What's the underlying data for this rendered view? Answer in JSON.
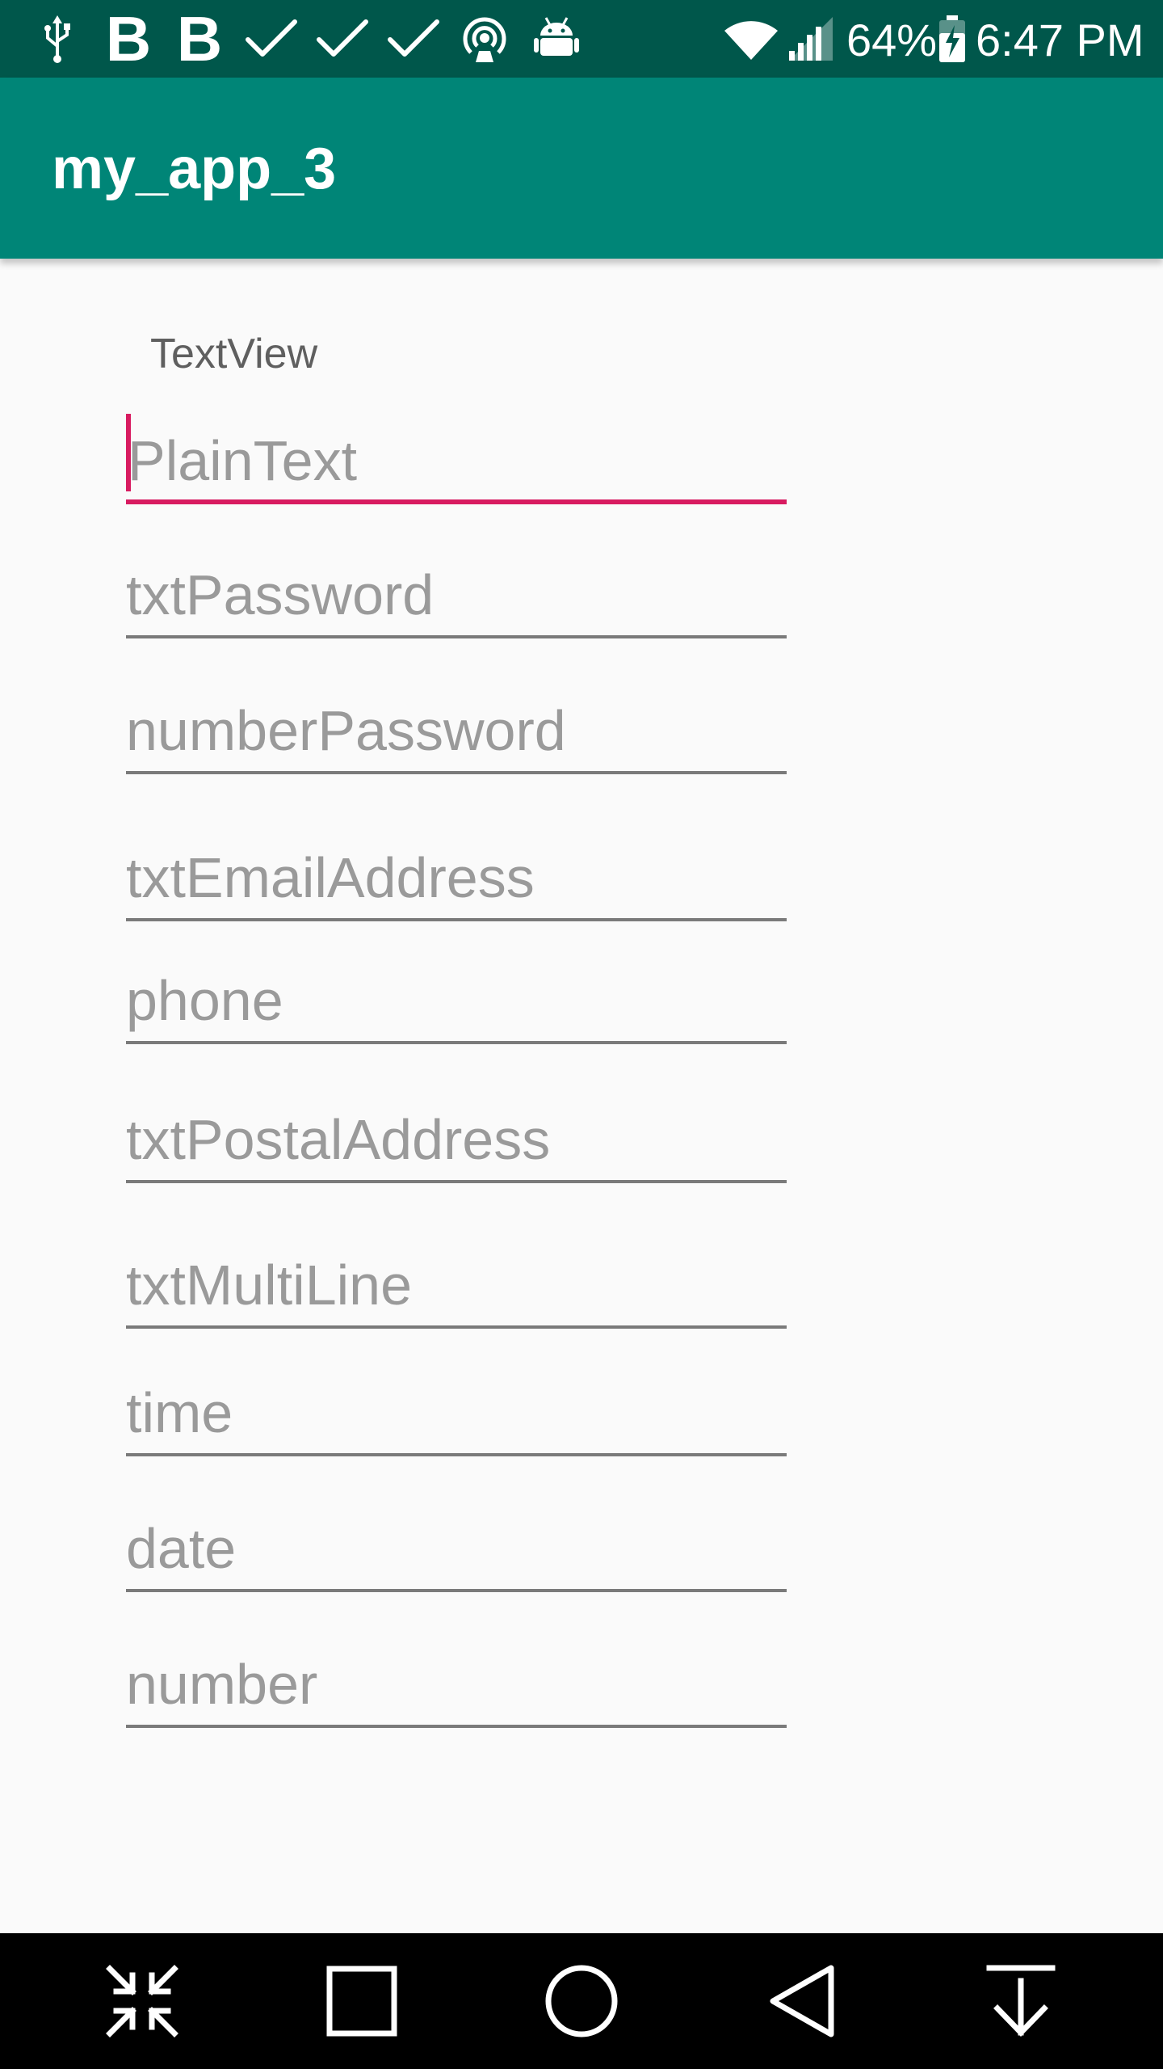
{
  "status_bar": {
    "left_icons": [
      "usb-icon",
      "b-icon",
      "b-icon",
      "check-icon",
      "check-icon",
      "check-icon",
      "hotspot-icon",
      "android-icon"
    ],
    "b_glyph_1": "B",
    "b_glyph_2": "B",
    "right_icons": [
      "wifi-icon",
      "signal-icon",
      "battery-charging-icon"
    ],
    "battery_percent": "64%",
    "time": "6:47 PM"
  },
  "app_bar": {
    "title": "my_app_3"
  },
  "content": {
    "textview_label": "TextView",
    "fields": [
      {
        "name": "plaintext",
        "placeholder": "PlainText",
        "focused": true
      },
      {
        "name": "txtpassword",
        "placeholder": "txtPassword"
      },
      {
        "name": "numberpassword",
        "placeholder": "numberPassword"
      },
      {
        "name": "txtemailaddress",
        "placeholder": "txtEmailAddress"
      },
      {
        "name": "phone",
        "placeholder": "phone"
      },
      {
        "name": "txtpostaladdress",
        "placeholder": "txtPostalAddress"
      },
      {
        "name": "txtmultiline",
        "placeholder": "txtMultiLine"
      },
      {
        "name": "time",
        "placeholder": "time"
      },
      {
        "name": "date",
        "placeholder": "date"
      },
      {
        "name": "number",
        "placeholder": "number"
      }
    ]
  },
  "nav_bar": {
    "buttons": [
      "collapse-icon",
      "recents-icon",
      "home-icon",
      "back-icon",
      "download-icon"
    ]
  },
  "colors": {
    "status_bar": "#00574b",
    "app_bar": "#008577",
    "accent": "#d81b60",
    "background": "#fafafa",
    "nav_bar": "#000000"
  }
}
